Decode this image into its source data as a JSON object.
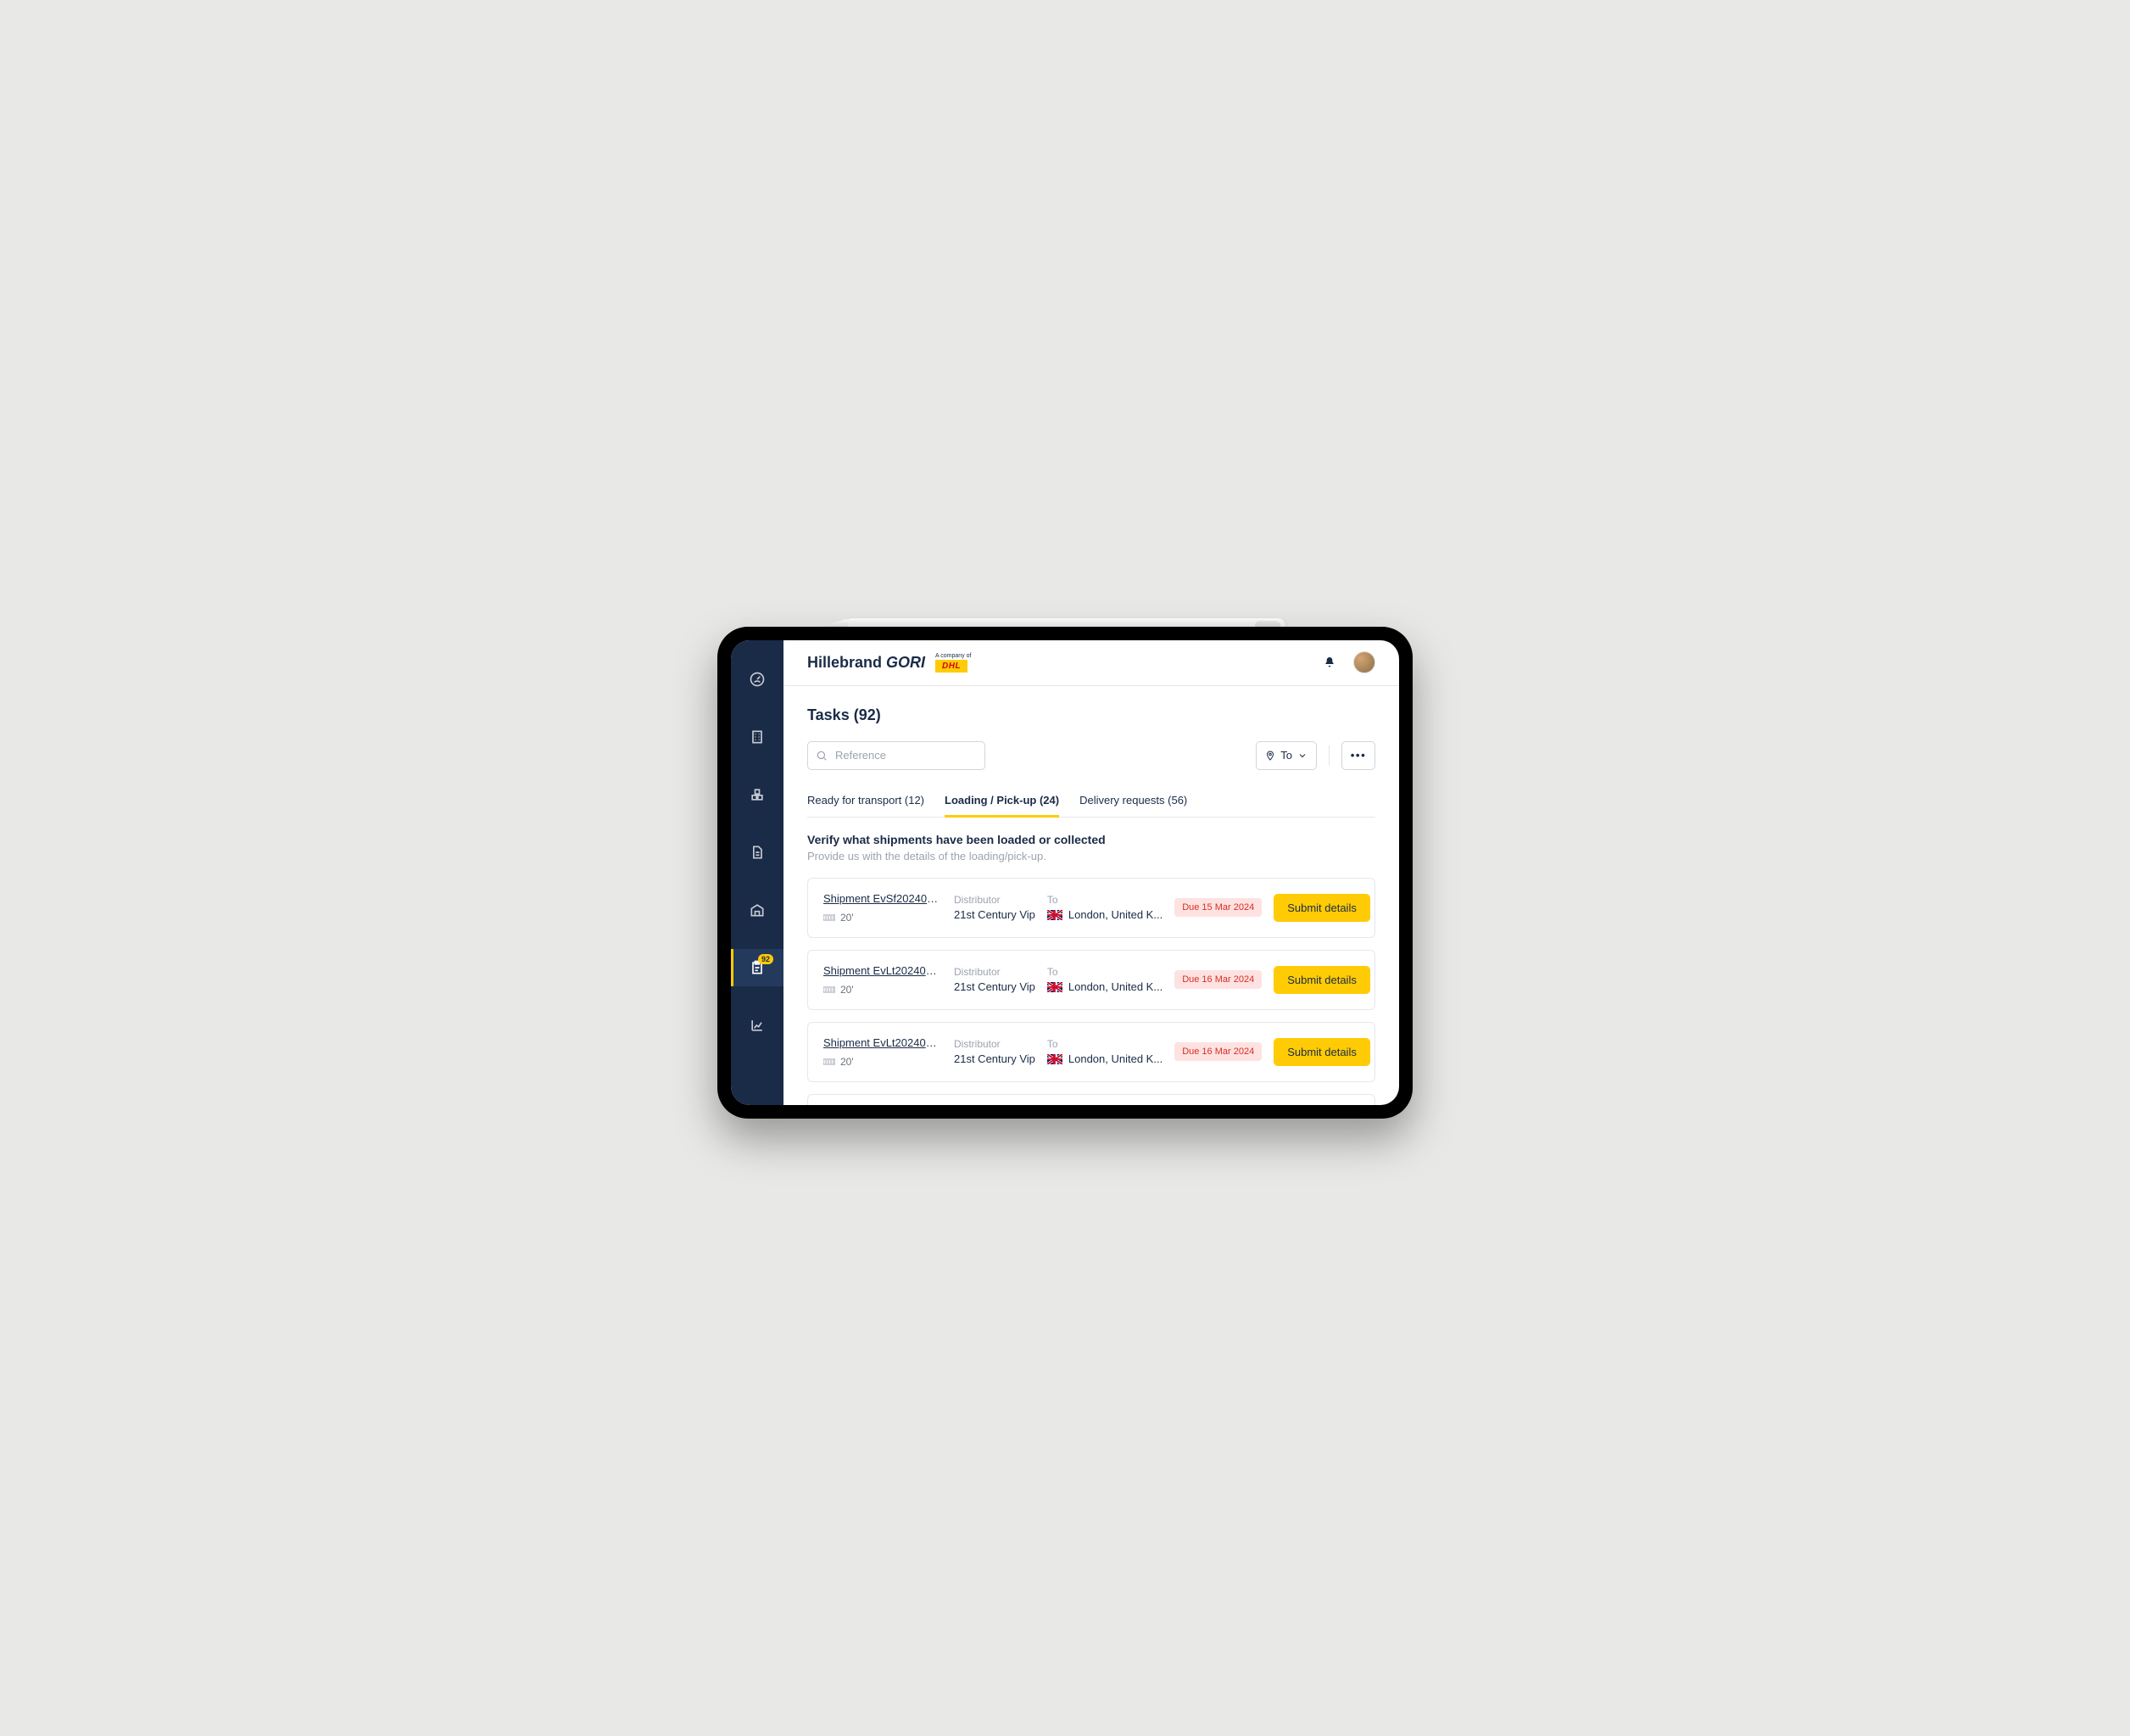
{
  "brand": {
    "name_a": "Hillebrand",
    "name_b": "GORI",
    "parent_line": "A company of",
    "parent_brand": "DHL"
  },
  "sidebar": {
    "badge": "92"
  },
  "page": {
    "title": "Tasks (92)"
  },
  "search": {
    "placeholder": "Reference"
  },
  "filters": {
    "to_label": "To",
    "more_label": "•••"
  },
  "tabs": [
    {
      "label": "Ready for transport (12)",
      "active": false
    },
    {
      "label": "Loading / Pick-up (24)",
      "active": true
    },
    {
      "label": "Delivery requests (56)",
      "active": false
    }
  ],
  "section": {
    "title": "Verify what shipments have been loaded or collected",
    "subtitle": "Provide us with the details of the loading/pick-up."
  },
  "columns": {
    "distributor": "Distributor",
    "to": "To"
  },
  "rows": [
    {
      "shipment": "Shipment EvSf2024031...",
      "size": "20'",
      "distributor": "21st Century Vip",
      "destination": "London, United K...",
      "due": "Due 15 Mar 2024",
      "action": "Submit details"
    },
    {
      "shipment": "Shipment EvLt2024031...",
      "size": "20'",
      "distributor": "21st Century Vip",
      "destination": "London, United K...",
      "due": "Due 16 Mar 2024",
      "action": "Submit details"
    },
    {
      "shipment": "Shipment EvLt2024031...",
      "size": "20'",
      "distributor": "21st Century Vip",
      "destination": "London, United K...",
      "due": "Due 16 Mar 2024",
      "action": "Submit details"
    }
  ]
}
